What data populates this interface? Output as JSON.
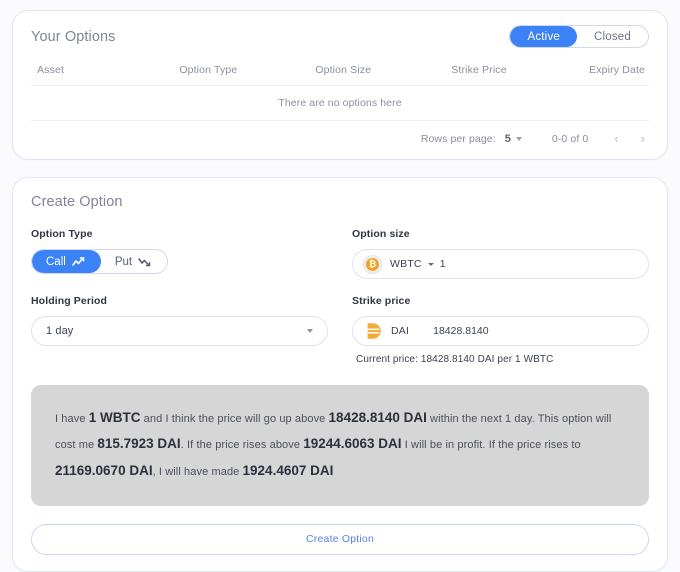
{
  "options_card": {
    "title": "Your Options",
    "filters": [
      {
        "label": "Active",
        "active": true
      },
      {
        "label": "Closed",
        "active": false
      }
    ],
    "columns": [
      "Asset",
      "Option Type",
      "Option Size",
      "Strike Price",
      "Expiry Date"
    ],
    "empty_message": "There are no options here",
    "pagination": {
      "rows_per_page_label": "Rows per page:",
      "rows_per_page_value": "5",
      "range": "0-0 of 0",
      "prev_icon": "chevron-left-icon",
      "next_icon": "chevron-right-icon"
    }
  },
  "create_card": {
    "title": "Create Option",
    "option_type": {
      "label": "Option Type",
      "call_label": "Call",
      "put_label": "Put",
      "selected": "Call"
    },
    "option_size": {
      "label": "Option size",
      "token": "WBTC",
      "token_icon": "wbtc-icon",
      "amount": "1"
    },
    "holding_period": {
      "label": "Holding Period",
      "value": "1 day"
    },
    "strike_price": {
      "label": "Strike price",
      "token": "DAI",
      "token_icon": "dai-icon",
      "value": "18428.8140",
      "current_price_text": "Current price: 18428.8140 DAI per 1 WBTC"
    },
    "summary": {
      "t1": "I have ",
      "v1": "1 WBTC",
      "t2": " and I think the price will go up above ",
      "v2": "18428.8140 DAI",
      "t3": " within the next 1 day. This option will cost me ",
      "v3": "815.7923 DAI",
      "t4": ". If the price rises above ",
      "v4": "19244.6063 DAI",
      "t5": " I will be in profit. If the price rises to ",
      "v5": "21169.0670 DAI",
      "t6": ", I will have made ",
      "v6": "1924.4607 DAI"
    },
    "submit_label": "Create Option"
  },
  "colors": {
    "accent": "#3b82f6",
    "wbtc": "#f0a32a",
    "dai": "#f5ac37",
    "card_border": "#dfe6f7",
    "summary_bg": "#d6d6d6"
  }
}
